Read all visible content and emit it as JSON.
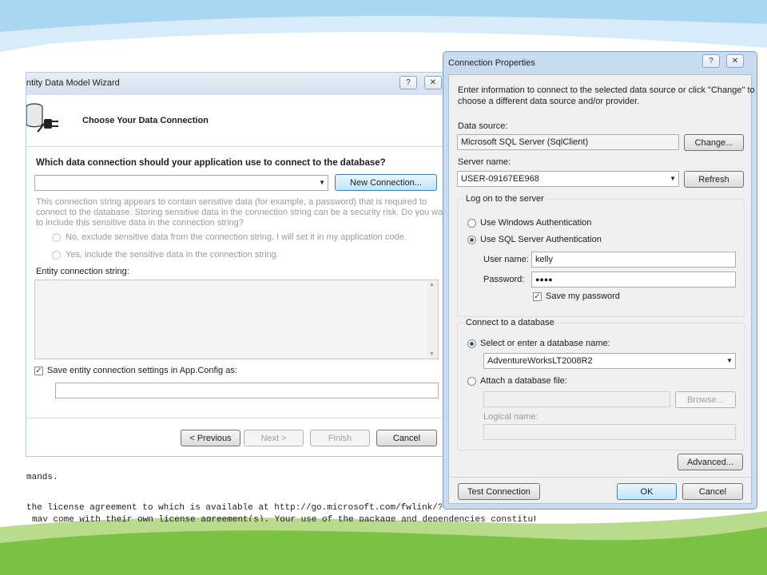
{
  "wizard": {
    "title": "ntity Data Model Wizard",
    "help_glyph": "?",
    "close_glyph": "✕",
    "header_title": "Choose Your Data Connection",
    "question": "Which data connection should your application use to connect to the database?",
    "connection_selected": "",
    "new_connection_label": "New Connection...",
    "sensitive_note": [
      "This connection string appears to contain sensitive data (for example, a password) that is required to",
      "connect to the database. Storing sensitive data in the connection string can be a security risk. Do you want",
      "to include this sensitive data in the connection string?"
    ],
    "option_exclude": "No, exclude sensitive data from the connection string. I will set it in my application code.",
    "option_include": "Yes, include the sensitive data in the connection string.",
    "entity_string_label": "Entity connection string:",
    "entity_string_value": "",
    "save_settings_label": "Save entity connection settings in App.Config as:",
    "save_settings_value": "",
    "previous_label": "< Previous",
    "next_label": "Next >",
    "finish_label": "Finish",
    "cancel_label": "Cancel"
  },
  "console": {
    "line1": "mands.",
    "line2": "the license agreement to which is available at http://go.microsoft.com/fwlink/?LinkI",
    "line3": "may come with their own license agreement(s). Your use of the package and dependencies constitutes your"
  },
  "conn": {
    "title": "Connection Properties",
    "help_glyph": "?",
    "close_glyph": "✕",
    "intro": [
      "Enter information to connect to the selected data source or click \"Change\" to",
      "choose a different data source and/or provider."
    ],
    "data_source_label": "Data source:",
    "data_source_value": "Microsoft SQL Server (SqlClient)",
    "change_label": "Change...",
    "server_name_label": "Server name:",
    "server_name_value": "USER-09167EE968",
    "refresh_label": "Refresh",
    "logon_group": "Log on to the server",
    "windows_auth": "Use Windows Authentication",
    "sql_auth": "Use SQL Server Authentication",
    "username_label": "User name:",
    "username_value": "kelly",
    "password_label": "Password:",
    "password_value": "●●●●",
    "save_password": "Save my password",
    "db_group": "Connect to a database",
    "select_db": "Select or enter a database name:",
    "db_value": "AdventureWorksLT2008R2",
    "attach_db": "Attach a database file:",
    "attach_value": "",
    "browse_label": "Browse...",
    "logical_name_label": "Logical name:",
    "logical_value": "",
    "advanced_label": "Advanced...",
    "test_label": "Test Connection",
    "ok_label": "OK",
    "cancel_label": "Cancel"
  },
  "colors": {
    "sky": "#4aa3df",
    "grass": "#7cc242",
    "dialog_border": "#7f9db9"
  }
}
